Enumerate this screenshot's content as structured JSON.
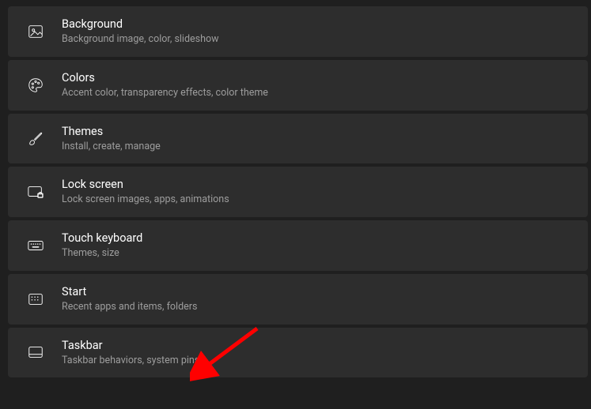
{
  "items": [
    {
      "title": "Background",
      "desc": "Background image, color, slideshow"
    },
    {
      "title": "Colors",
      "desc": "Accent color, transparency effects, color theme"
    },
    {
      "title": "Themes",
      "desc": "Install, create, manage"
    },
    {
      "title": "Lock screen",
      "desc": "Lock screen images, apps, animations"
    },
    {
      "title": "Touch keyboard",
      "desc": "Themes, size"
    },
    {
      "title": "Start",
      "desc": "Recent apps and items, folders"
    },
    {
      "title": "Taskbar",
      "desc": "Taskbar behaviors, system pins"
    }
  ]
}
